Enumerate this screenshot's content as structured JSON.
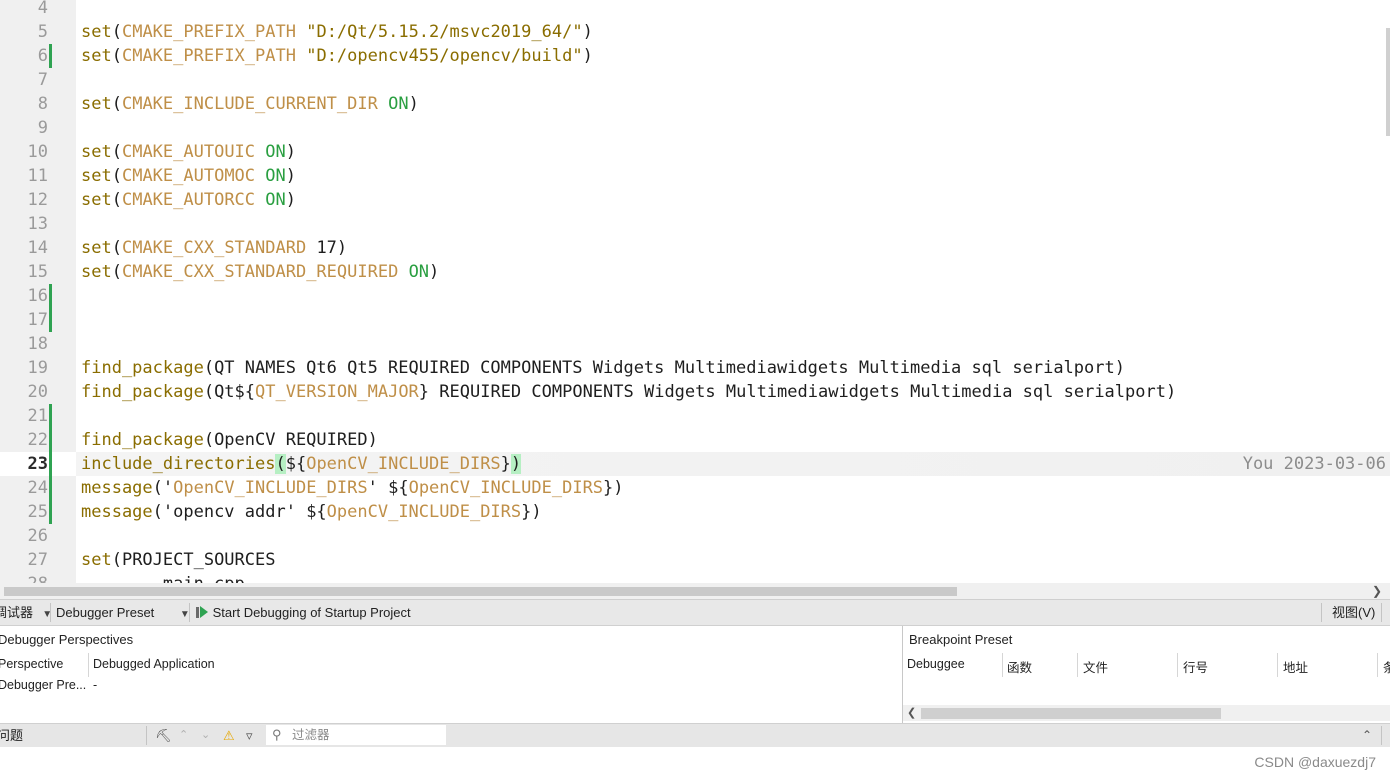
{
  "editor": {
    "lines": [
      {
        "n": "4",
        "tokens": []
      },
      {
        "n": "5",
        "tokens": [
          [
            "kw",
            "set"
          ],
          [
            "p",
            "("
          ],
          [
            "var",
            "CMAKE_PREFIX_PATH"
          ],
          [
            "p",
            " "
          ],
          [
            "str",
            "\"D:/Qt/5.15.2/msvc2019_64/\""
          ],
          [
            "p",
            ")"
          ]
        ]
      },
      {
        "n": "6",
        "mod": true,
        "tokens": [
          [
            "kw",
            "set"
          ],
          [
            "p",
            "("
          ],
          [
            "var",
            "CMAKE_PREFIX_PATH"
          ],
          [
            "p",
            " "
          ],
          [
            "str",
            "\"D:/opencv455/opencv/build\""
          ],
          [
            "p",
            ")"
          ]
        ]
      },
      {
        "n": "7",
        "tokens": []
      },
      {
        "n": "8",
        "tokens": [
          [
            "kw",
            "set"
          ],
          [
            "p",
            "("
          ],
          [
            "var",
            "CMAKE_INCLUDE_CURRENT_DIR"
          ],
          [
            "p",
            " "
          ],
          [
            "val",
            "ON"
          ],
          [
            "p",
            ")"
          ]
        ]
      },
      {
        "n": "9",
        "tokens": []
      },
      {
        "n": "10",
        "tokens": [
          [
            "kw",
            "set"
          ],
          [
            "p",
            "("
          ],
          [
            "var",
            "CMAKE_AUTOUIC"
          ],
          [
            "p",
            " "
          ],
          [
            "val",
            "ON"
          ],
          [
            "p",
            ")"
          ]
        ]
      },
      {
        "n": "11",
        "tokens": [
          [
            "kw",
            "set"
          ],
          [
            "p",
            "("
          ],
          [
            "var",
            "CMAKE_AUTOMOC"
          ],
          [
            "p",
            " "
          ],
          [
            "val",
            "ON"
          ],
          [
            "p",
            ")"
          ]
        ]
      },
      {
        "n": "12",
        "tokens": [
          [
            "kw",
            "set"
          ],
          [
            "p",
            "("
          ],
          [
            "var",
            "CMAKE_AUTORCC"
          ],
          [
            "p",
            " "
          ],
          [
            "val",
            "ON"
          ],
          [
            "p",
            ")"
          ]
        ]
      },
      {
        "n": "13",
        "tokens": []
      },
      {
        "n": "14",
        "tokens": [
          [
            "kw",
            "set"
          ],
          [
            "p",
            "("
          ],
          [
            "var",
            "CMAKE_CXX_STANDARD"
          ],
          [
            "p",
            " 17)"
          ]
        ]
      },
      {
        "n": "15",
        "tokens": [
          [
            "kw",
            "set"
          ],
          [
            "p",
            "("
          ],
          [
            "var",
            "CMAKE_CXX_STANDARD_REQUIRED"
          ],
          [
            "p",
            " "
          ],
          [
            "val",
            "ON"
          ],
          [
            "p",
            ")"
          ]
        ]
      },
      {
        "n": "16",
        "mod": true,
        "tokens": []
      },
      {
        "n": "17",
        "mod": true,
        "tokens": []
      },
      {
        "n": "18",
        "tokens": []
      },
      {
        "n": "19",
        "tokens": [
          [
            "kw",
            "find_package"
          ],
          [
            "p",
            "(QT NAMES Qt6 Qt5 REQUIRED COMPONENTS Widgets Multimediawidgets Multimedia sql serialport)"
          ]
        ]
      },
      {
        "n": "20",
        "tokens": [
          [
            "kw",
            "find_package"
          ],
          [
            "p",
            "(Qt"
          ],
          [
            "dol",
            "${"
          ],
          [
            "var",
            "QT_VERSION_MAJOR"
          ],
          [
            "dol",
            "}"
          ],
          [
            "p",
            " REQUIRED COMPONENTS Widgets Multimediawidgets Multimedia sql serialport)"
          ]
        ]
      },
      {
        "n": "21",
        "mod": true,
        "tokens": []
      },
      {
        "n": "22",
        "mod": true,
        "tokens": [
          [
            "kw",
            "find_package"
          ],
          [
            "p",
            "(OpenCV REQUIRED)"
          ]
        ]
      },
      {
        "n": "23",
        "mod": true,
        "current": true,
        "blame": "You 2023-03-06",
        "tokens": [
          [
            "kw",
            "include_directories"
          ],
          [
            "brh",
            "("
          ],
          [
            "dol",
            "${"
          ],
          [
            "var",
            "OpenCV_INCLUDE_DIRS"
          ],
          [
            "dol",
            "}"
          ],
          [
            "brh",
            ")"
          ]
        ]
      },
      {
        "n": "24",
        "mod": true,
        "tokens": [
          [
            "kw",
            "message"
          ],
          [
            "p",
            "('"
          ],
          [
            "var",
            "OpenCV_INCLUDE_DIRS"
          ],
          [
            "p",
            "' "
          ],
          [
            "dol",
            "${"
          ],
          [
            "var",
            "OpenCV_INCLUDE_DIRS"
          ],
          [
            "dol",
            "}"
          ],
          [
            "p",
            ")"
          ]
        ]
      },
      {
        "n": "25",
        "mod": true,
        "tokens": [
          [
            "kw",
            "message"
          ],
          [
            "p",
            "('opencv addr' "
          ],
          [
            "dol",
            "${"
          ],
          [
            "var",
            "OpenCV_INCLUDE_DIRS"
          ],
          [
            "dol",
            "}"
          ],
          [
            "p",
            ")"
          ]
        ]
      },
      {
        "n": "26",
        "tokens": []
      },
      {
        "n": "27",
        "tokens": [
          [
            "kw",
            "set"
          ],
          [
            "p",
            "(PROJECT_SOURCES"
          ]
        ]
      },
      {
        "n": "28",
        "tokens": [
          [
            "p",
            "        main.cpp"
          ]
        ]
      }
    ]
  },
  "toolbar": {
    "debugger_label": "调试器",
    "preset_label": "Debugger Preset",
    "start_label": "Start Debugging of Startup Project",
    "view_label": "视图(V)"
  },
  "perspectives": {
    "title": "Debugger Perspectives",
    "col_perspective": "Perspective",
    "col_app": "Debugged Application",
    "row_perspective": "Debugger Pre...",
    "row_app": "-"
  },
  "breakpoints": {
    "title": "Breakpoint Preset",
    "columns": [
      "Debuggee",
      "函数",
      "文件",
      "行号",
      "地址",
      "条"
    ]
  },
  "statusbar": {
    "issues_label": "问题",
    "filter_placeholder": "过滤器"
  },
  "watermark": "CSDN @daxuezdj7",
  "colors": {
    "keyword": "#8a6d00",
    "variable": "#bf8f48",
    "value": "#2a9f41",
    "modified_marker": "#2fa352",
    "bracket_highlight": "#b6efc3"
  }
}
